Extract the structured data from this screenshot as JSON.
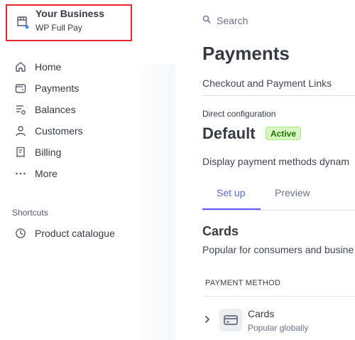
{
  "account": {
    "name": "Your Business",
    "subtitle": "WP Full Pay"
  },
  "sidebar": {
    "items": [
      {
        "label": "Home",
        "icon": "home-icon"
      },
      {
        "label": "Payments",
        "icon": "wallet-icon"
      },
      {
        "label": "Balances",
        "icon": "balances-icon"
      },
      {
        "label": "Customers",
        "icon": "person-icon"
      },
      {
        "label": "Billing",
        "icon": "receipt-icon"
      },
      {
        "label": "More",
        "icon": "more-dots-icon"
      }
    ],
    "shortcuts_heading": "Shortcuts",
    "shortcuts": [
      {
        "label": "Product catalogue",
        "icon": "clock-icon"
      }
    ]
  },
  "search": {
    "label": "Search",
    "icon": "search-icon"
  },
  "main": {
    "title": "Payments",
    "subtitle": "Checkout and Payment Links",
    "config_label": "Direct configuration",
    "config_name": "Default",
    "status_badge": "Active",
    "description": "Display payment methods dynam",
    "tabs": [
      {
        "label": "Set up",
        "selected": true
      },
      {
        "label": "Preview",
        "selected": false
      }
    ],
    "cards_section": {
      "heading": "Cards",
      "description": "Popular for consumers and busine",
      "column_header": "PAYMENT METHOD",
      "rows": [
        {
          "name": "Cards",
          "note": "Popular globally"
        }
      ]
    }
  },
  "colors": {
    "accent": "#635bff",
    "tab_active_text": "#5469d4",
    "badge_bg": "#d7f7c2",
    "badge_text": "#217005",
    "highlight_border": "#e5262b"
  }
}
